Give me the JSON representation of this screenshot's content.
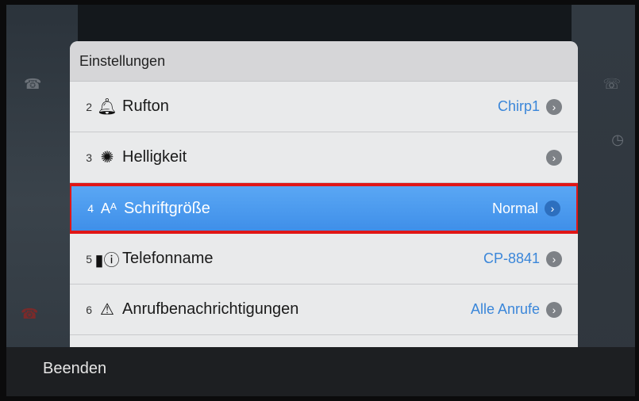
{
  "panel": {
    "title": "Einstellungen"
  },
  "rows": [
    {
      "num": "2",
      "icon": "bell-icon",
      "label": "Rufton",
      "value": "Chirp1"
    },
    {
      "num": "3",
      "icon": "brightness-icon",
      "label": "Helligkeit",
      "value": ""
    },
    {
      "num": "4",
      "icon": "font-size-icon",
      "label": "Schriftgröße",
      "value": "Normal",
      "selected": true
    },
    {
      "num": "5",
      "icon": "phone-name-icon",
      "label": "Telefonname",
      "value": "CP-8841"
    },
    {
      "num": "6",
      "icon": "warning-icon",
      "label": "Anrufbenachrichtigungen",
      "value": "Alle Anrufe"
    }
  ],
  "softkeys": {
    "exit_label": "Beenden"
  },
  "colors": {
    "selection": "#3f8fe9",
    "highlight_border": "#e01616",
    "value_text": "#3a86d9"
  }
}
